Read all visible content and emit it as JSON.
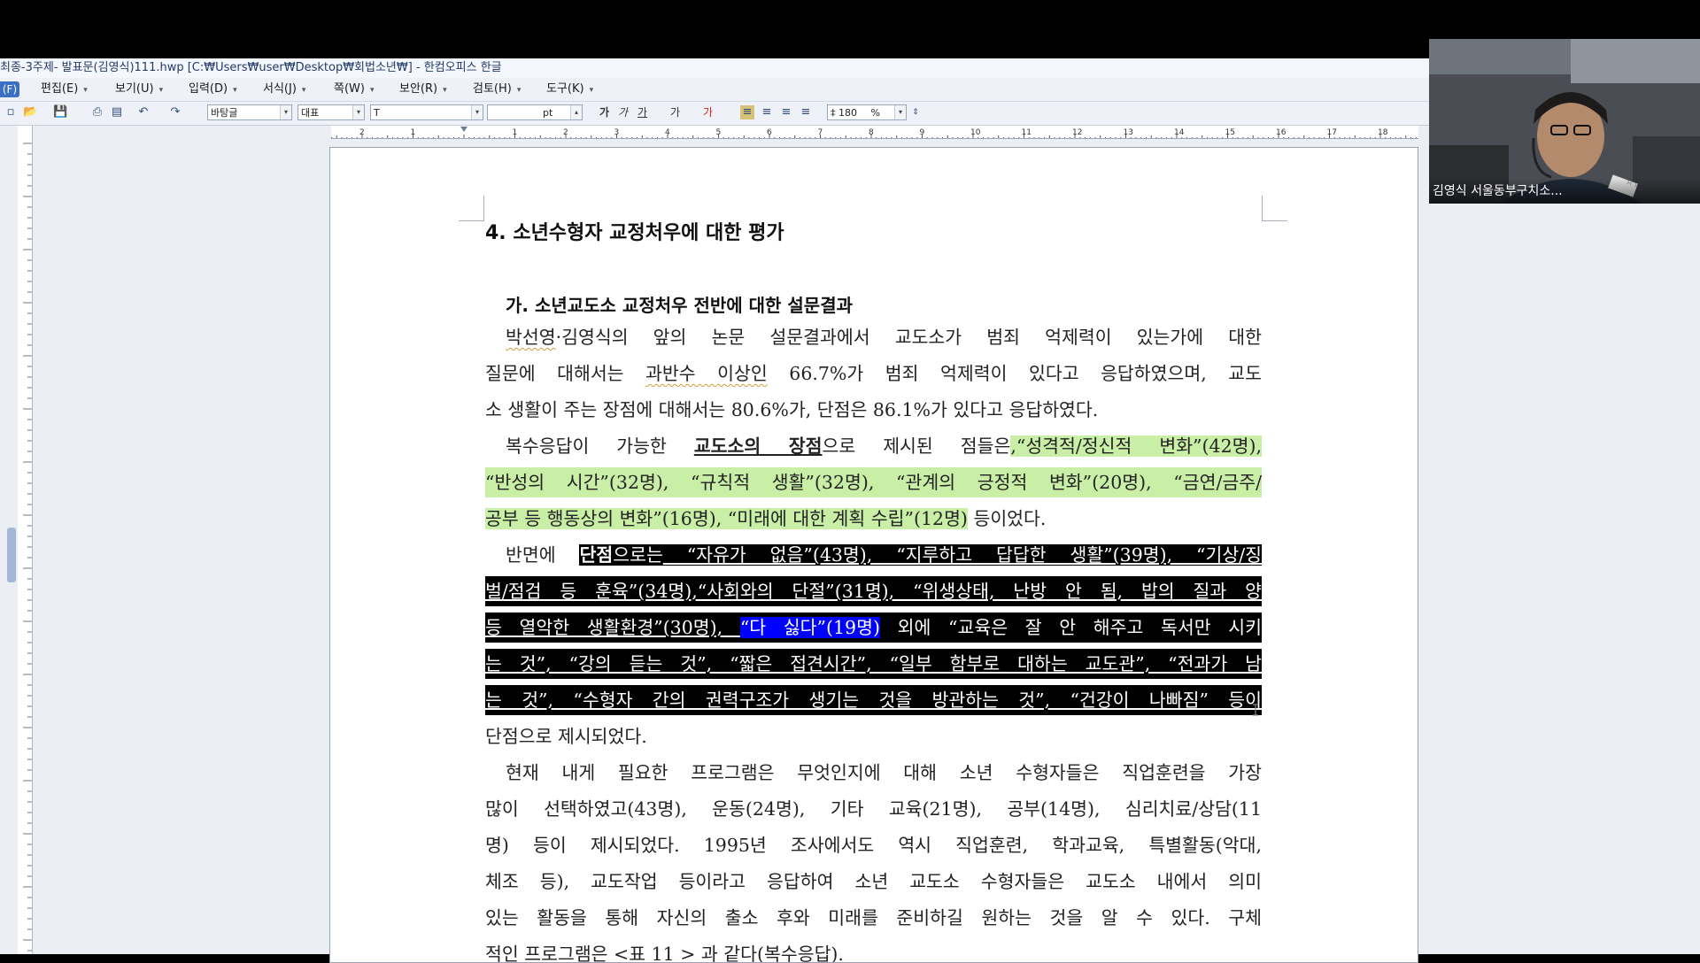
{
  "window": {
    "title": "최종-3주제- 발표문(김영식)111.hwp [C:₩Users₩user₩Desktop₩회법소년₩] - 한컴오피스 한글"
  },
  "menu": {
    "file_label": "(F)",
    "items": [
      "편집(E)",
      "보기(U)",
      "입력(D)",
      "서식(J)",
      "쪽(W)",
      "보안(R)",
      "검토(H)",
      "도구(K)"
    ]
  },
  "toolbar": {
    "style_value": "바탕글",
    "rep_value": "대표",
    "font_value": "T",
    "size_unit": "pt",
    "bold_label": "가",
    "italic_label": "가",
    "underline_label": "가",
    "strike_label": "가",
    "color_label": "가",
    "line_spacing_value": "180",
    "line_spacing_unit": "%"
  },
  "ruler": {
    "numbers": [
      "2",
      "1",
      "1",
      "2",
      "3",
      "4",
      "5",
      "6",
      "7",
      "8",
      "9",
      "10",
      "11",
      "12",
      "13",
      "14",
      "15",
      "16",
      "17",
      "18"
    ]
  },
  "document": {
    "heading4": "4. 소년수형자 교정처우에 대한 평가",
    "heading_ga": "가. 소년교도소 교정처우 전반에 대한 설문결과",
    "p1": {
      "l1_a": "박선영",
      "l1_b": "·김영식의 앞의 논문 설문결과에서 교도소가 범죄 억제력이 있는가에 대한",
      "l2_a": "질문에 대해서는 ",
      "l2_b": "과반수 이상인",
      "l2_c": " 66.7%가 범죄 억제력이 있다고 응답하였으며, 교도",
      "l3": "소 생활이 주는 장점에 대해서는 80.6%가, 단점은 86.1%가 있다고 응답하였다."
    },
    "p2": {
      "l1_a": "복수응답이 가능한 ",
      "l1_b": "교도소의 장점",
      "l1_c": "으로 제시된 점들은",
      "l1_d": ",“성격적/정신적 변화”(42명),",
      "l2": "“반성의 시간”(32명), “규칙적 생활”(32명), “관계의 긍정적 변화”(20명), “금연/금주/",
      "l3_a": "공부 등 행동상의 변화”(16명), “미래에 대한 계획 수립”(12명)",
      "l3_b": " 등이었다."
    },
    "p3": {
      "l1_a": "반면에 ",
      "l1_b": "단점",
      "l1_c": "으로는",
      "l1_d": " “자유가 없음”(43명), “지루하고 답답한 생활”(39명), “기상/징",
      "l2": "벌/점검 등 훈육”(34명),“사회와의 단절”(31명), “위생상태, 난방 안 됨, 밥의 질과 양",
      "l3_a": "등 열악한 생활환경”(30명), ",
      "l3_b": "“다 싫다”(19명)",
      "l3_c": " 외에 “교육은 잘 안 해주고 독서만 시키",
      "l4": "는 것”, “강의 듣는 것”, “짧은 접견시간”, “일부 함부로 대하는 교도관”, “전과가 남",
      "l5": "는 것”, “수형자 간의 권력구조가 생기는 것을 방관하는 것”, “건강이 나빠짐” 등이",
      "l6": "단점으로 제시되었다."
    },
    "p4": {
      "l1": "현재 내게 필요한 프로그램은 무엇인지에 대해 소년 수형자들은 직업훈련을 가장",
      "l2": "많이 선택하였고(43명), 운동(24명), 기타 교육(21명), 공부(14명), 심리치료/상담(11",
      "l3": "명) 등이 제시되었다. 1995년 조사에서도 역시 직업훈련, 학과교육, 특별활동(악대,",
      "l4": "체조 등), 교도작업 등이라고 응답하여 소년 교도소 수형자들은 교도소 내에서 의미",
      "l5": "있는 활동을 통해 자신의 출소 후와 미래를 준비하길 원하는 것을 알 수 있다. 구체",
      "l6": "적인 프로그램은 <표 11 > 과 같다(복수응답)."
    }
  },
  "video": {
    "participant_name": "김영식 서울동부구치소...",
    "badge": "☆☆"
  },
  "colors": {
    "highlight_green": "#c9efa7",
    "selection_black": "#000000",
    "selection_blue": "#0000ff",
    "menu_accent": "#3b6fc4"
  }
}
